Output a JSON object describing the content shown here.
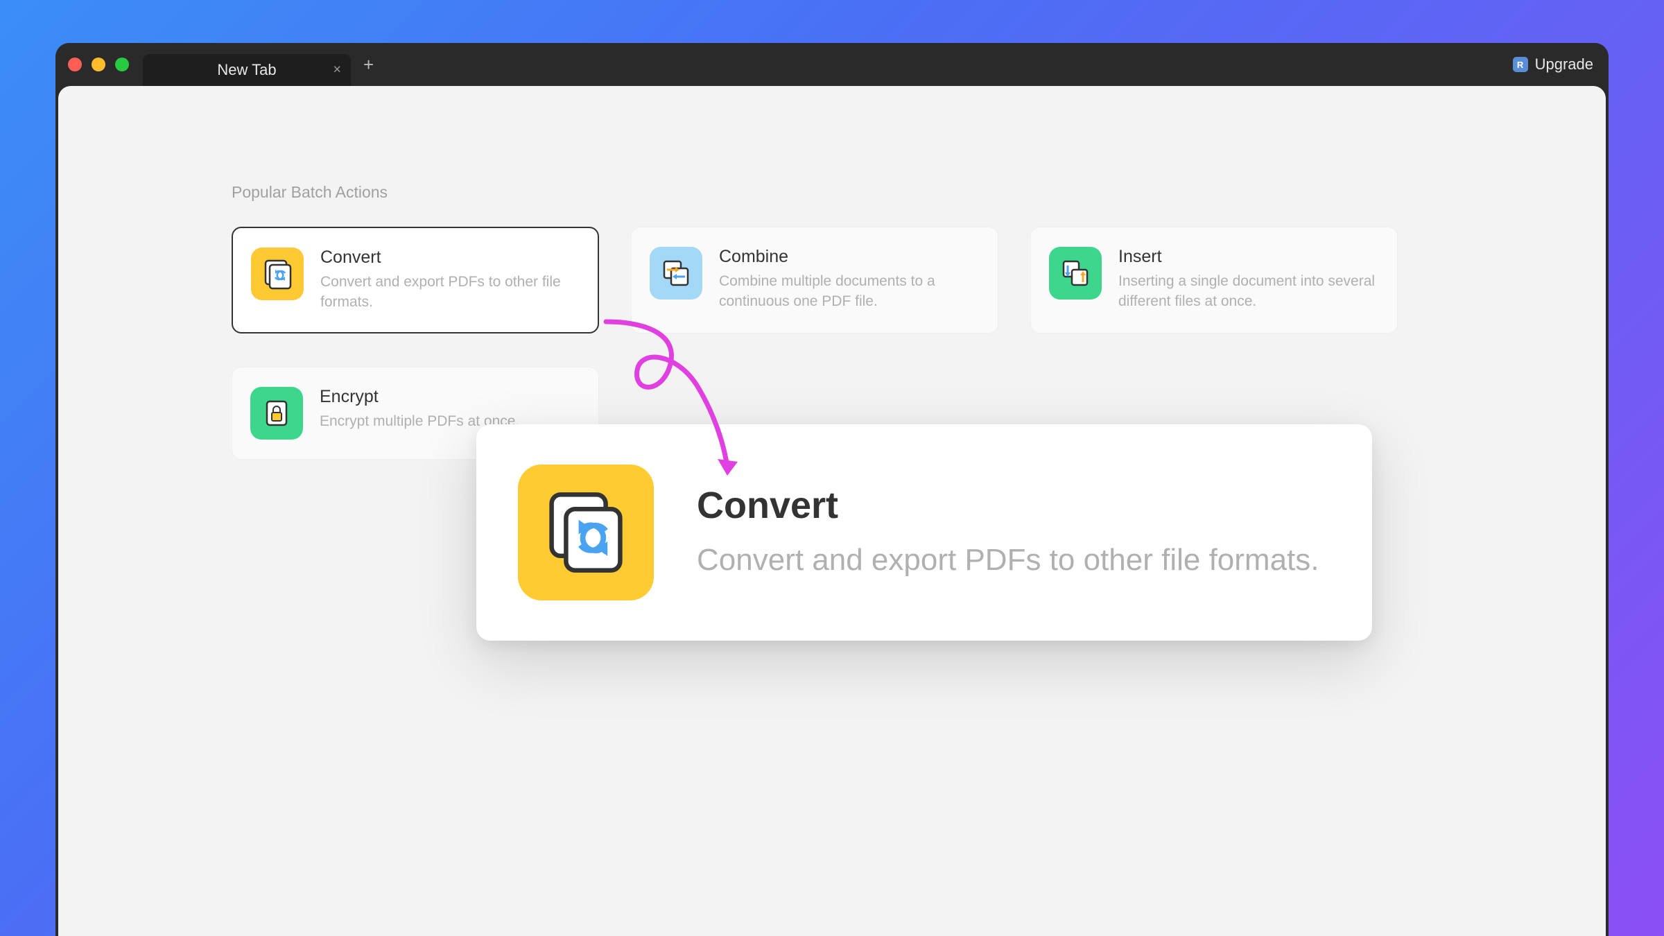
{
  "window": {
    "tab_title": "New Tab",
    "upgrade_label": "Upgrade"
  },
  "section": {
    "title": "Popular Batch Actions",
    "cards": [
      {
        "title": "Convert",
        "desc": "Convert and export PDFs to other file formats.",
        "icon": "convert",
        "selected": true
      },
      {
        "title": "Combine",
        "desc": "Combine multiple documents to a continuous one PDF file.",
        "icon": "combine",
        "selected": false
      },
      {
        "title": "Insert",
        "desc": "Inserting a single document into several different files at once.",
        "icon": "insert",
        "selected": false
      },
      {
        "title": "Encrypt",
        "desc": "Encrypt multiple PDFs at once.",
        "icon": "encrypt",
        "selected": false
      }
    ]
  },
  "zoom": {
    "title": "Convert",
    "desc": "Convert and export PDFs to other file formats."
  },
  "annotation": {
    "arrow_color": "#E040E0"
  }
}
